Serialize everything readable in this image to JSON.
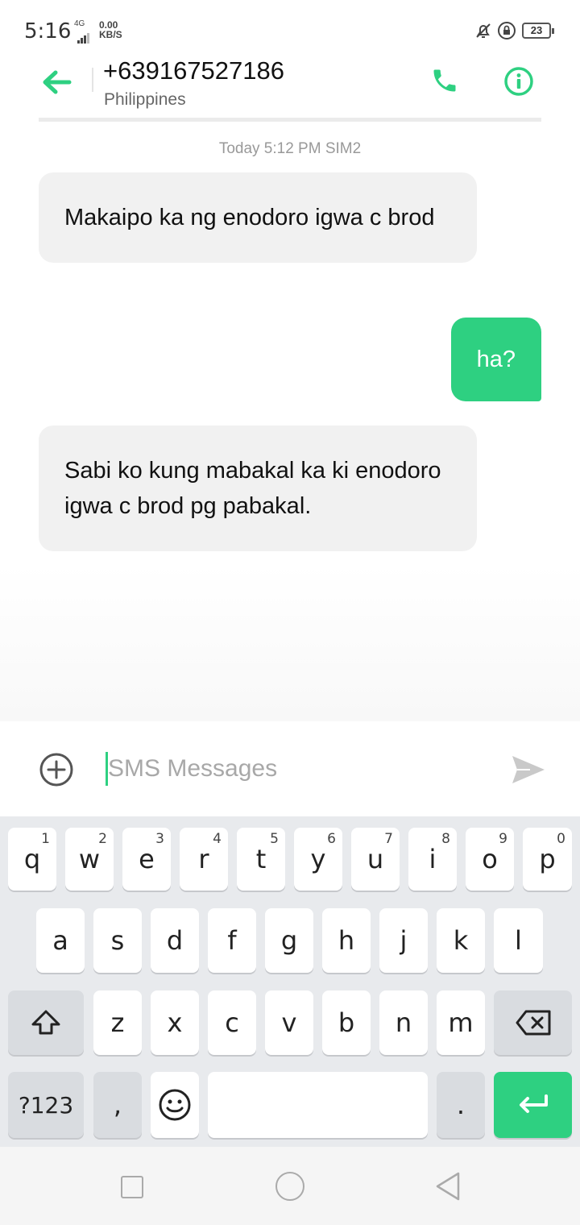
{
  "status_bar": {
    "time": "5:16",
    "network": "4G",
    "speed_value": "0.00",
    "speed_unit": "KB/S",
    "battery": "23"
  },
  "header": {
    "contact_number": "+639167527186",
    "contact_location": "Philippines"
  },
  "conversation": {
    "timestamp": "Today 5:12 PM  SIM2",
    "messages": [
      {
        "direction": "incoming",
        "text": "Makaipo ka ng enodoro igwa c brod"
      },
      {
        "direction": "outgoing",
        "text": "ha?"
      },
      {
        "direction": "incoming",
        "text": "Sabi ko kung mabakal ka ki enodoro igwa c brod pg pabakal."
      }
    ]
  },
  "compose": {
    "placeholder": "SMS Messages",
    "value": ""
  },
  "keyboard": {
    "row1": [
      {
        "key": "q",
        "hint": "1"
      },
      {
        "key": "w",
        "hint": "2"
      },
      {
        "key": "e",
        "hint": "3"
      },
      {
        "key": "r",
        "hint": "4"
      },
      {
        "key": "t",
        "hint": "5"
      },
      {
        "key": "y",
        "hint": "6"
      },
      {
        "key": "u",
        "hint": "7"
      },
      {
        "key": "i",
        "hint": "8"
      },
      {
        "key": "o",
        "hint": "9"
      },
      {
        "key": "p",
        "hint": "0"
      }
    ],
    "row2": [
      "a",
      "s",
      "d",
      "f",
      "g",
      "h",
      "j",
      "k",
      "l"
    ],
    "row3": [
      "z",
      "x",
      "c",
      "v",
      "b",
      "n",
      "m"
    ],
    "symbols_label": "?123",
    "comma_label": ",",
    "period_label": "."
  },
  "colors": {
    "accent": "#2ed081",
    "incoming_bubble": "#f1f1f1",
    "keyboard_bg": "#e8eaed"
  },
  "icons": {
    "back": "arrow-left-icon",
    "call": "phone-icon",
    "info": "info-icon",
    "add": "plus-circle-icon",
    "send": "send-icon"
  }
}
